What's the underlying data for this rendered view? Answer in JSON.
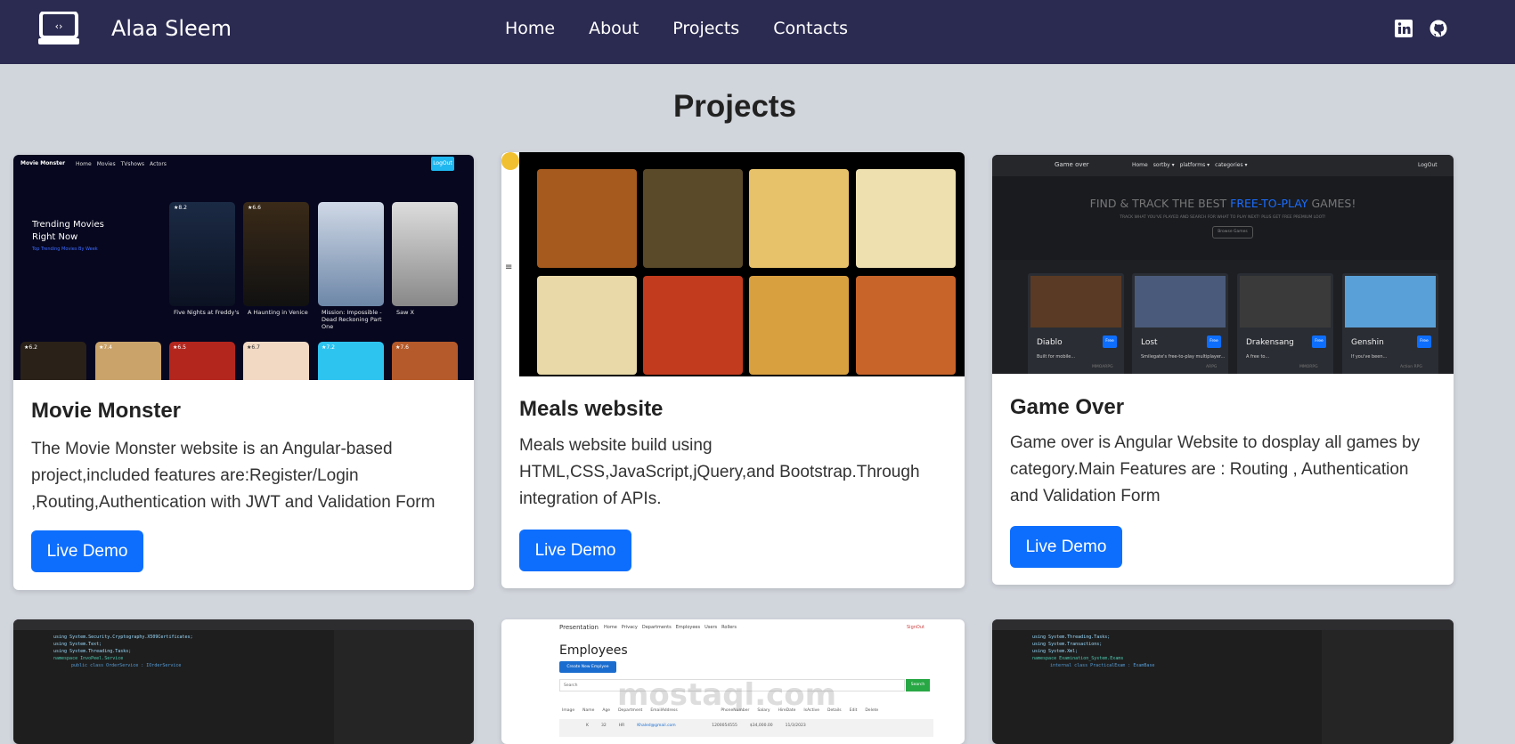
{
  "nav": {
    "brand": "Alaa Sleem",
    "links": [
      "Home",
      "About",
      "Projects",
      "Contacts"
    ],
    "social_icons": [
      "linkedin-icon",
      "github-icon"
    ]
  },
  "page_title": "Projects",
  "projects": [
    {
      "title": "Movie Monster",
      "description": "The Movie Monster website is an Angular-based project,included features are:Register/Login ,Routing,Authentication with JWT and Validation Form",
      "button": "Live Demo",
      "preview": {
        "brand": "Movie Monster",
        "menu": [
          "Home",
          "Movies",
          "TVshows",
          "Actors"
        ],
        "logout": "LogOut",
        "heading": "Trending Movies Right Now",
        "sub": "Top Trending Movies By Week",
        "movies": [
          {
            "title": "Five Nights at Freddy's",
            "rating": "8.2"
          },
          {
            "title": "A Haunting in Venice",
            "rating": "6.6"
          },
          {
            "title": "Mission: Impossible - Dead Reckoning Part One",
            "rating": ""
          },
          {
            "title": "Saw X",
            "rating": ""
          }
        ],
        "row2_ratings": [
          "6.2",
          "7.4",
          "6.5",
          "6.7",
          "7.2",
          "7.6"
        ]
      }
    },
    {
      "title": "Meals website",
      "description": "Meals website build using HTML,CSS,JavaScript,jQuery,and Bootstrap.Through integration of APIs.",
      "button": "Live Demo"
    },
    {
      "title": "Game Over",
      "description": "Game over is Angular Website to dosplay all games by category.Main Features are : Routing , Authentication and Validation Form",
      "button": "Live Demo",
      "preview": {
        "brand": "Game over",
        "menu": [
          "Home",
          "sortby ▾",
          "platforms ▾",
          "categories ▾"
        ],
        "logout": "LogOut",
        "hero_a": "FIND & TRACK THE BEST ",
        "hero_b": "FREE-TO-PLAY",
        "hero_c": " GAMES!",
        "hero_sub": "TRACK WHAT YOU'VE PLAYED AND SEARCH FOR WHAT TO PLAY NEXT! PLUS GET FREE PREMIUM LOOT!",
        "browse": "Browse Games",
        "free": "Free",
        "games": [
          {
            "name": "Diablo",
            "desc": "Built for mobile...",
            "genre": "MMOARPG"
          },
          {
            "name": "Lost",
            "desc": "Smilegate's free-to-play multiplayer...",
            "genre": "ARPG"
          },
          {
            "name": "Drakensang",
            "desc": "A free to...",
            "genre": "MMORPG"
          },
          {
            "name": "Genshin",
            "desc": "If you've been...",
            "genre": "Action RPG"
          }
        ]
      }
    },
    {
      "preview": {
        "code": [
          "using System.Security.Cryptography.X509Certificates;",
          "using System.Text;",
          "using System.Threading.Tasks;",
          "namespace InvoPeel.Service",
          "public class OrderService : IOrderService"
        ]
      }
    },
    {
      "preview": {
        "brand": "Presentation",
        "menu": [
          "Home",
          "Privacy",
          "Departments",
          "Employees",
          "Users",
          "Rollers"
        ],
        "signout": "SignOut",
        "heading": "Employees",
        "create": "Create New Emplyee",
        "search_placeholder": "Search",
        "search_btn": "Search",
        "columns": [
          "Image",
          "Name",
          "Age",
          "Department",
          "EmailAddress",
          "PhoneNumber",
          "Salary",
          "HireDate",
          "IsActive",
          "Details",
          "Edit",
          "Delete"
        ],
        "row": [
          "",
          "K",
          "32",
          "HR",
          "Khaled@gmail.com",
          "1200054555",
          "$34,000.00",
          "11/3/2023"
        ],
        "watermark": "mostaql.com"
      }
    },
    {
      "preview": {
        "code": [
          "using System.Threading.Tasks;",
          "using System.Transactions;",
          "using System.Xml;",
          "namespace Examination_System.Exams",
          "internal class PracticalExam : ExamBase"
        ]
      }
    }
  ]
}
